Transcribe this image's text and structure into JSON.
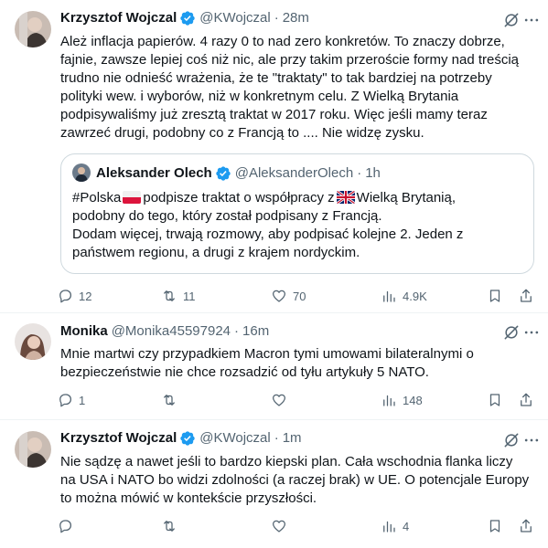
{
  "tweets": [
    {
      "name": "Krzysztof Wojczal",
      "handle": "@KWojczal",
      "time": "28m",
      "text": "Ależ inflacja papierów. 4 razy 0 to nad zero konkretów. To znaczy dobrze,\nfajnie, zawsze lepiej coś niż nic, ale przy takim przeroście formy nad treścią\ntrudno nie odnieść wrażenia, że te \"traktaty\" to tak bardziej na potrzeby\npolityki wew. i wyborów, niż w konkretnym celu. Z Wielką Brytania\npodpisywaliśmy już zresztą traktat w 2017 roku. Więc jeśli mamy teraz\nzawrzeć drugi, podobny co z Francją to .... Nie widzę zysku.",
      "quote": {
        "name": "Aleksander Olech",
        "handle": "@AleksanderOlech",
        "time": "1h",
        "line1_a": "#Polska",
        "line1_b": "podpisze traktat o współpracy z",
        "line1_c": "Wielką Brytanią,",
        "rest": "podobny do tego, który został podpisany z Francją.\nDodam więcej, trwają rozmowy, aby podpisać kolejne 2. Jeden z\npaństwem regionu, a drugi z krajem nordyckim."
      },
      "stats": {
        "replies": "12",
        "retweets": "11",
        "likes": "70",
        "views": "4.9K"
      }
    },
    {
      "name": "Monika",
      "handle": "@Monika45597924",
      "time": "16m",
      "text": "Mnie martwi czy przypadkiem Macron tymi umowami bilateralnymi o\nbezpieczeństwie nie chce rozsadzić od tyłu artykuły 5 NATO.",
      "stats": {
        "replies": "1",
        "retweets": "",
        "likes": "",
        "views": "148"
      }
    },
    {
      "name": "Krzysztof Wojczal",
      "handle": "@KWojczal",
      "time": "1m",
      "text": "Nie sądzę a nawet jeśli to bardzo kiepski plan. Cała wschodnia flanka liczy\nna USA i NATO bo widzi zdolności (a raczej brak) w UE. O potencjale Europy\nto można mówić w kontekście przyszłości.",
      "stats": {
        "replies": "",
        "retweets": "",
        "likes": "",
        "views": "4"
      }
    }
  ],
  "colors": {
    "text": "#0f1419",
    "muted": "#536471",
    "verified": "#1d9bf0",
    "border": "#cfd9de"
  }
}
